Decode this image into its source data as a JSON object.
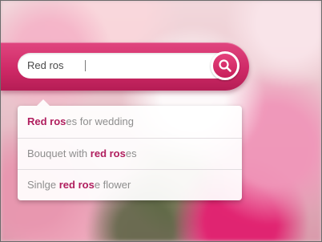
{
  "search": {
    "value": "Red ros",
    "button_icon": "magnifier-icon"
  },
  "suggestions": [
    {
      "before": "",
      "match": "Red ros",
      "after": "es for wedding"
    },
    {
      "before": "Bouquet with ",
      "match": "red ros",
      "after": "es"
    },
    {
      "before": "Sinlge ",
      "match": "red ros",
      "after": "e flower"
    }
  ],
  "colors": {
    "accent": "#d12f6a",
    "highlight_text": "#b01e5e",
    "suggestion_text": "#8e8e8e"
  }
}
